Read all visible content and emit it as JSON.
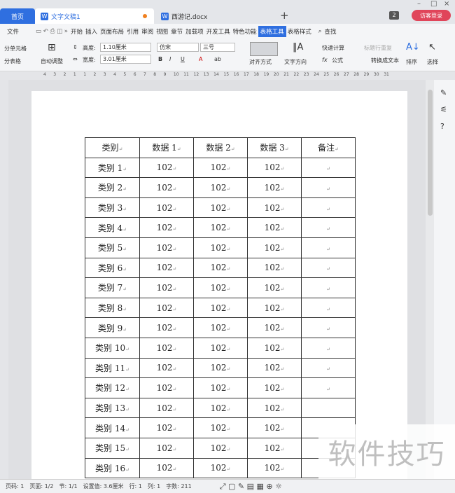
{
  "tabs": {
    "home": "首页",
    "doc1": "文字文稿1",
    "doc2": "西游记.docx"
  },
  "window": {
    "badge": "2",
    "visitor": "访客登录"
  },
  "menu": [
    "文件",
    "开始",
    "插入",
    "页面布局",
    "引用",
    "审阅",
    "视图",
    "章节",
    "加载项",
    "开发工具",
    "特色功能",
    "表格工具",
    "表格样式",
    "查找"
  ],
  "ribbon": {
    "split_cells": "分单元格",
    "split_table": "分表格",
    "autofit": "自动调整",
    "height_label": "高度:",
    "height_value": "1.10厘米",
    "width_label": "宽度:",
    "width_value": "3.01厘米",
    "font": "仿宋",
    "size": "三号",
    "align": "对齐方式",
    "text_dir": "文字方向",
    "quick_calc": "快速计算",
    "repeat_header": "标题行重复",
    "formula": "公式",
    "to_text": "转换成文本",
    "sort": "排序",
    "select": "选择"
  },
  "ruler_ticks": [
    "4",
    "3",
    "2",
    "1",
    "1",
    "2",
    "3",
    "4",
    "5",
    "6",
    "7",
    "8",
    "9",
    "10",
    "11",
    "12",
    "13",
    "14",
    "15",
    "16",
    "17",
    "18",
    "19",
    "20",
    "21",
    "22",
    "23",
    "24",
    "25",
    "26",
    "27",
    "28",
    "29",
    "30",
    "31"
  ],
  "table": {
    "header": [
      "类别",
      "数据 1",
      "数据 2",
      "数据 3",
      "备注"
    ],
    "rows": [
      [
        "类别 1",
        "102",
        "102",
        "102",
        ""
      ],
      [
        "类别 2",
        "102",
        "102",
        "102",
        ""
      ],
      [
        "类别 3",
        "102",
        "102",
        "102",
        ""
      ],
      [
        "类别 4",
        "102",
        "102",
        "102",
        ""
      ],
      [
        "类别 5",
        "102",
        "102",
        "102",
        ""
      ],
      [
        "类别 6",
        "102",
        "102",
        "102",
        ""
      ],
      [
        "类别 7",
        "102",
        "102",
        "102",
        ""
      ],
      [
        "类别 8",
        "102",
        "102",
        "102",
        ""
      ],
      [
        "类别 9",
        "102",
        "102",
        "102",
        ""
      ],
      [
        "类别 10",
        "102",
        "102",
        "102",
        ""
      ],
      [
        "类别 11",
        "102",
        "102",
        "102",
        ""
      ],
      [
        "类别 12",
        "102",
        "102",
        "102",
        ""
      ],
      [
        "类别 13",
        "102",
        "102",
        "102",
        ""
      ],
      [
        "类别 14",
        "102",
        "102",
        "102",
        ""
      ],
      [
        "类别 15",
        "102",
        "102",
        "102",
        ""
      ],
      [
        "类别 16",
        "102",
        "102",
        "102",
        ""
      ]
    ]
  },
  "status": {
    "page_no": "页码: 1",
    "pages": "页面: 1/2",
    "section": "节: 1/1",
    "setting": "设置值: 3.6厘米",
    "row": "行: 1",
    "col": "列: 1",
    "words": "字数: 211"
  },
  "watermark": "软件技巧",
  "colors": {
    "accent": "#2f6fe0",
    "visitor": "#e0455a"
  }
}
